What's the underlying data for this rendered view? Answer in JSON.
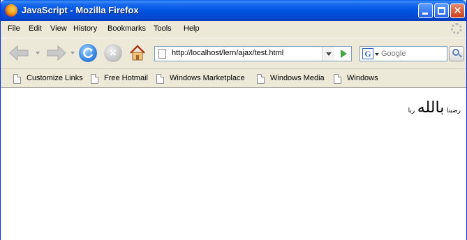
{
  "window": {
    "title": "JavaScript - Mozilla Firefox",
    "close_glyph": "✕"
  },
  "menu": {
    "items": [
      "File",
      "Edit",
      "View",
      "History",
      "Bookmarks",
      "Tools",
      "Help"
    ]
  },
  "toolbar": {
    "url": "http://localhost/lern/ajax/test.html",
    "search_placeholder": "Google",
    "search_engine_glyph": "G",
    "stop_glyph": "×"
  },
  "bookmarks": {
    "items": [
      "Customize Links",
      "Free Hotmail",
      "Windows Marketplace",
      "Windows Media",
      "Windows"
    ]
  },
  "content": {
    "word1": "رضينا",
    "word2": "بالله",
    "word3": "ربا"
  }
}
